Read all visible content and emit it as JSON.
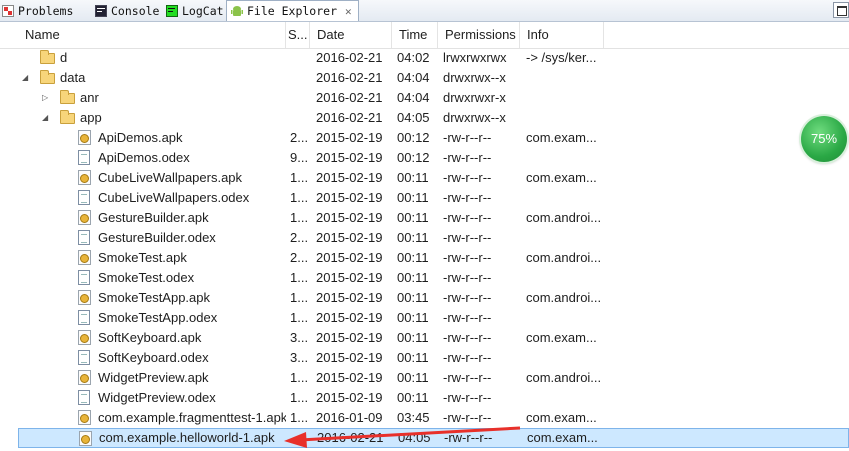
{
  "tabs": [
    {
      "label": "Problems",
      "icon": "problems-icon"
    },
    {
      "label": "Console",
      "icon": "console-icon"
    },
    {
      "label": "LogCat",
      "icon": "logcat-icon"
    },
    {
      "label": "File Explorer",
      "icon": "android-icon",
      "active": true
    }
  ],
  "columns": [
    "Name",
    "S...",
    "Date",
    "Time",
    "Permissions",
    "Info"
  ],
  "rows": [
    {
      "name": "d",
      "size": "",
      "date": "2016-02-21",
      "time": "04:02",
      "perm": "lrwxrwxrwx",
      "info": "-> /sys/ker...",
      "type": "folder",
      "depth": 1,
      "twisty": ""
    },
    {
      "name": "data",
      "size": "",
      "date": "2016-02-21",
      "time": "04:04",
      "perm": "drwxrwx--x",
      "info": "",
      "type": "folder",
      "depth": 1,
      "twisty": "expanded"
    },
    {
      "name": "anr",
      "size": "",
      "date": "2016-02-21",
      "time": "04:04",
      "perm": "drwxrwxr-x",
      "info": "",
      "type": "folder",
      "depth": 2,
      "twisty": "collapsed"
    },
    {
      "name": "app",
      "size": "",
      "date": "2016-02-21",
      "time": "04:05",
      "perm": "drwxrwx--x",
      "info": "",
      "type": "folder",
      "depth": 2,
      "twisty": "expanded"
    },
    {
      "name": "ApiDemos.apk",
      "size": "2...",
      "date": "2015-02-19",
      "time": "00:12",
      "perm": "-rw-r--r--",
      "info": "com.exam...",
      "type": "apk",
      "depth": 3
    },
    {
      "name": "ApiDemos.odex",
      "size": "9...",
      "date": "2015-02-19",
      "time": "00:12",
      "perm": "-rw-r--r--",
      "info": "",
      "type": "file",
      "depth": 3
    },
    {
      "name": "CubeLiveWallpapers.apk",
      "size": "1...",
      "date": "2015-02-19",
      "time": "00:11",
      "perm": "-rw-r--r--",
      "info": "com.exam...",
      "type": "apk",
      "depth": 3
    },
    {
      "name": "CubeLiveWallpapers.odex",
      "size": "1...",
      "date": "2015-02-19",
      "time": "00:11",
      "perm": "-rw-r--r--",
      "info": "",
      "type": "file",
      "depth": 3
    },
    {
      "name": "GestureBuilder.apk",
      "size": "1...",
      "date": "2015-02-19",
      "time": "00:11",
      "perm": "-rw-r--r--",
      "info": "com.androi...",
      "type": "apk",
      "depth": 3
    },
    {
      "name": "GestureBuilder.odex",
      "size": "2...",
      "date": "2015-02-19",
      "time": "00:11",
      "perm": "-rw-r--r--",
      "info": "",
      "type": "file",
      "depth": 3
    },
    {
      "name": "SmokeTest.apk",
      "size": "2...",
      "date": "2015-02-19",
      "time": "00:11",
      "perm": "-rw-r--r--",
      "info": "com.androi...",
      "type": "apk",
      "depth": 3
    },
    {
      "name": "SmokeTest.odex",
      "size": "1...",
      "date": "2015-02-19",
      "time": "00:11",
      "perm": "-rw-r--r--",
      "info": "",
      "type": "file",
      "depth": 3
    },
    {
      "name": "SmokeTestApp.apk",
      "size": "1...",
      "date": "2015-02-19",
      "time": "00:11",
      "perm": "-rw-r--r--",
      "info": "com.androi...",
      "type": "apk",
      "depth": 3
    },
    {
      "name": "SmokeTestApp.odex",
      "size": "1...",
      "date": "2015-02-19",
      "time": "00:11",
      "perm": "-rw-r--r--",
      "info": "",
      "type": "file",
      "depth": 3
    },
    {
      "name": "SoftKeyboard.apk",
      "size": "3...",
      "date": "2015-02-19",
      "time": "00:11",
      "perm": "-rw-r--r--",
      "info": "com.exam...",
      "type": "apk",
      "depth": 3
    },
    {
      "name": "SoftKeyboard.odex",
      "size": "3...",
      "date": "2015-02-19",
      "time": "00:11",
      "perm": "-rw-r--r--",
      "info": "",
      "type": "file",
      "depth": 3
    },
    {
      "name": "WidgetPreview.apk",
      "size": "1...",
      "date": "2015-02-19",
      "time": "00:11",
      "perm": "-rw-r--r--",
      "info": "com.androi...",
      "type": "apk",
      "depth": 3
    },
    {
      "name": "WidgetPreview.odex",
      "size": "1...",
      "date": "2015-02-19",
      "time": "00:11",
      "perm": "-rw-r--r--",
      "info": "",
      "type": "file",
      "depth": 3
    },
    {
      "name": "com.example.fragmenttest-1.apk",
      "size": "1...",
      "date": "2016-01-09",
      "time": "03:45",
      "perm": "-rw-r--r--",
      "info": "com.exam...",
      "type": "apk",
      "depth": 3
    },
    {
      "name": "com.example.helloworld-1.apk",
      "size": "",
      "date": "2016-02-21",
      "time": "04:05",
      "perm": "-rw-r--r--",
      "info": "com.exam...",
      "type": "apk",
      "depth": 3,
      "selected": true
    }
  ],
  "progress": {
    "label": "75%",
    "value": 0.75,
    "color": "#2aa845"
  },
  "colors": {
    "selection": "#cde8ff",
    "annotation_arrow": "#e8302a"
  }
}
